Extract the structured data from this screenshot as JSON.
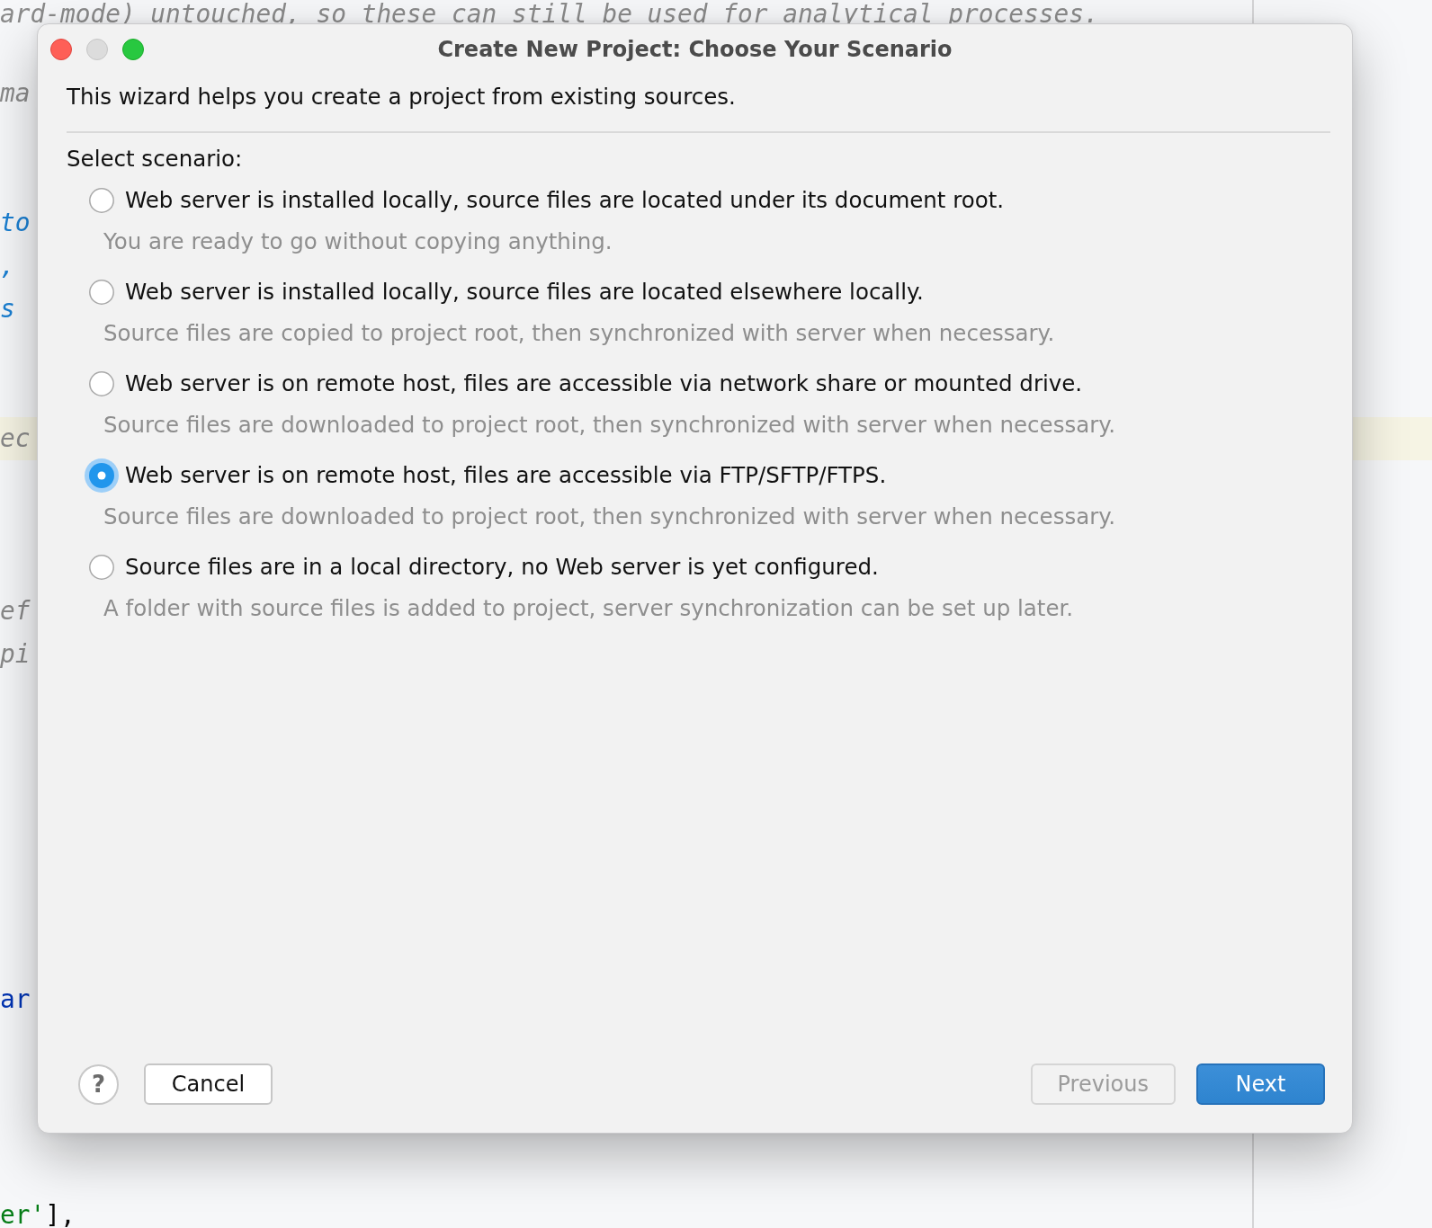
{
  "editor": {
    "lines": [
      {
        "highlighted": false,
        "segments": [
          {
            "text": "ard-mode) untouched, so these can still be used for analytical processes.",
            "kind": "comment"
          }
        ]
      },
      {
        "highlighted": false,
        "segments": [
          {
            "text": "ma",
            "kind": "comment"
          }
        ]
      },
      {
        "highlighted": false,
        "segments": [
          {
            "text": "to",
            "kind": "doc"
          }
        ]
      },
      {
        "highlighted": false,
        "segments": [
          {
            "text": ",",
            "kind": "doc"
          }
        ]
      },
      {
        "highlighted": false,
        "segments": [
          {
            "text": "s",
            "kind": "doc"
          }
        ]
      },
      {
        "highlighted": true,
        "segments": [
          {
            "text": "ec",
            "kind": "comment"
          }
        ]
      },
      {
        "highlighted": false,
        "segments": [
          {
            "text": "ef",
            "kind": "comment"
          }
        ]
      },
      {
        "highlighted": false,
        "segments": [
          {
            "text": "pi",
            "kind": "comment"
          }
        ]
      },
      {
        "highlighted": false,
        "segments": [
          {
            "text": "ar",
            "kind": "keyword"
          }
        ]
      },
      {
        "highlighted": false,
        "segments": [
          {
            "text": "er'",
            "kind": "string"
          },
          {
            "text": "],",
            "kind": "plain"
          }
        ]
      }
    ]
  },
  "dialog": {
    "window_controls": [
      {
        "kind": "close",
        "disabled": false
      },
      {
        "kind": "minimize",
        "disabled": true
      },
      {
        "kind": "zoom",
        "disabled": false
      }
    ],
    "title": "Create New Project: Choose Your Scenario",
    "intro": "This wizard helps you create a project from existing sources.",
    "prompt": "Select scenario:",
    "scenarios": [
      {
        "label": "Web server is installed locally, source files are located under its document root.",
        "description": "You are ready to go without copying anything.",
        "selected": false
      },
      {
        "label": "Web server is installed locally, source files are located elsewhere locally.",
        "description": "Source files are copied to project root, then synchronized with server when necessary.",
        "selected": false
      },
      {
        "label": "Web server is on remote host, files are accessible via network share or mounted drive.",
        "description": "Source files are downloaded to project root, then synchronized with server when necessary.",
        "selected": false
      },
      {
        "label": "Web server is on remote host, files are accessible via FTP/SFTP/FTPS.",
        "description": "Source files are downloaded to project root, then synchronized with server when necessary.",
        "selected": true
      },
      {
        "label": "Source files are in a local directory, no Web server is yet configured.",
        "description": "A folder with source files is added to project, server synchronization can be set up later.",
        "selected": false
      }
    ],
    "footer": {
      "help": "?",
      "left_buttons": [
        {
          "label": "Cancel",
          "kind": "secondary",
          "disabled": false
        }
      ],
      "right_buttons": [
        {
          "label": "Previous",
          "kind": "secondary",
          "disabled": true
        },
        {
          "label": "Next",
          "kind": "primary",
          "disabled": false
        }
      ]
    }
  }
}
